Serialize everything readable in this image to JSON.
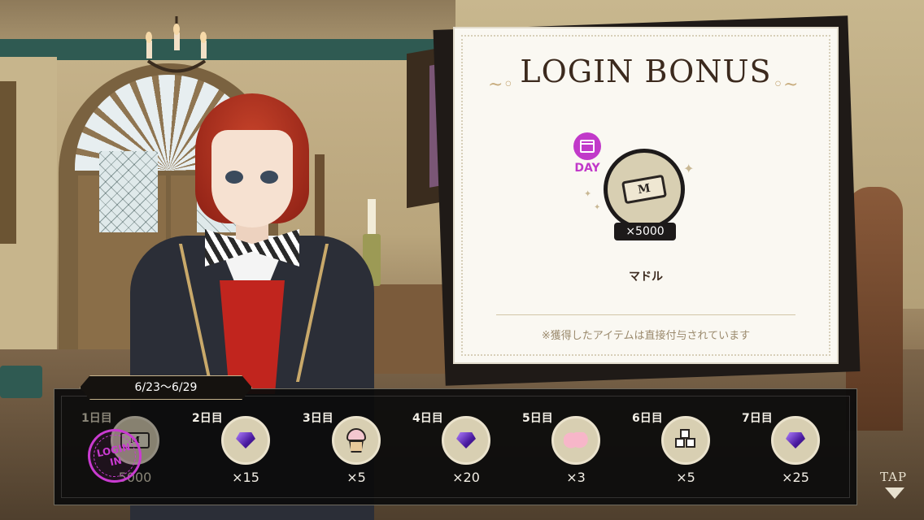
{
  "card": {
    "title": "LOGIN BONUS",
    "day_label": "DAY",
    "reward_item": "M",
    "reward_quantity": "×5000",
    "reward_name": "マドル",
    "note": "※獲得したアイテムは直接付与されています"
  },
  "schedule": {
    "date_range": "6/23〜6/29",
    "days": [
      {
        "label": "1日目",
        "icon": "madol-ticket-icon",
        "item": "M",
        "quantity": "5000",
        "claimed": true
      },
      {
        "label": "2日目",
        "icon": "magical-gem-icon",
        "quantity": "×15",
        "claimed": false
      },
      {
        "label": "3日目",
        "icon": "cupcake-icon",
        "quantity": "×5",
        "claimed": false
      },
      {
        "label": "4日目",
        "icon": "magical-gem-icon",
        "quantity": "×20",
        "claimed": false
      },
      {
        "label": "5日目",
        "icon": "pink-puff-icon",
        "quantity": "×3",
        "claimed": false
      },
      {
        "label": "6日目",
        "icon": "sugar-cubes-icon",
        "quantity": "×5",
        "claimed": false
      },
      {
        "label": "7日目",
        "icon": "magical-gem-icon",
        "quantity": "×25",
        "claimed": false
      }
    ]
  },
  "stamp": {
    "line1": "LOGIN",
    "line2": "IN"
  },
  "tap_prompt": "TAP",
  "colors": {
    "accent_magenta": "#c139c9",
    "card_bg": "#faf8f2",
    "strip_bg": "#0c0c0c"
  }
}
